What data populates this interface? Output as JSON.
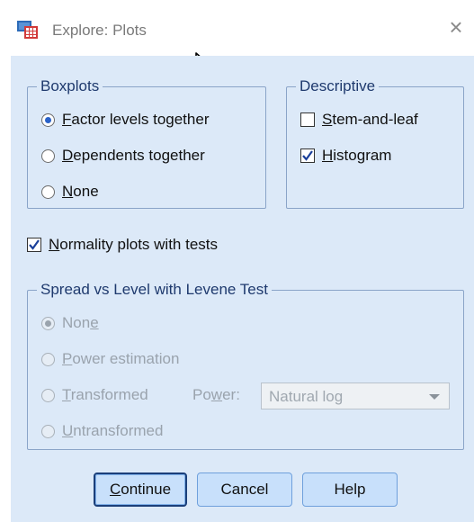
{
  "window": {
    "title": "Explore: Plots",
    "close_glyph": "×"
  },
  "boxplots": {
    "legend": "Boxplots",
    "options": [
      {
        "pre": "",
        "key": "F",
        "post": "actor levels together",
        "checked": true
      },
      {
        "pre": "",
        "key": "D",
        "post": "ependents together",
        "checked": false
      },
      {
        "pre": "",
        "key": "N",
        "post": "one",
        "checked": false
      }
    ]
  },
  "descriptive": {
    "legend": "Descriptive",
    "stem_leaf": {
      "pre": "",
      "key": "S",
      "post": "tem-and-leaf",
      "checked": false
    },
    "histogram": {
      "pre": "",
      "key": "H",
      "post": "istogram",
      "checked": true
    }
  },
  "normality": {
    "pre": "",
    "key": "N",
    "post": "ormality plots with tests",
    "checked": true
  },
  "spread": {
    "legend": "Spread vs Level with Levene Test",
    "none": {
      "pre": "Non",
      "key": "e",
      "post": "",
      "checked": true
    },
    "power_estimation": {
      "pre": "",
      "key": "P",
      "post": "ower estimation",
      "checked": false
    },
    "transformed": {
      "pre": "",
      "key": "T",
      "post": "ransformed",
      "checked": false
    },
    "power_label": {
      "pre": "Po",
      "key": "w",
      "post": "er:"
    },
    "power_value": "Natural log",
    "untransformed": {
      "pre": "",
      "key": "U",
      "post": "ntransformed",
      "checked": false
    }
  },
  "buttons": {
    "continue": {
      "pre": "",
      "key": "C",
      "post": "ontinue"
    },
    "cancel": "Cancel",
    "help": "Help"
  },
  "icons": {
    "app": "spss-app-icon",
    "close": "close-icon",
    "cursor": "mouse-pointer-icon",
    "dropdown": "chevron-down-icon"
  }
}
